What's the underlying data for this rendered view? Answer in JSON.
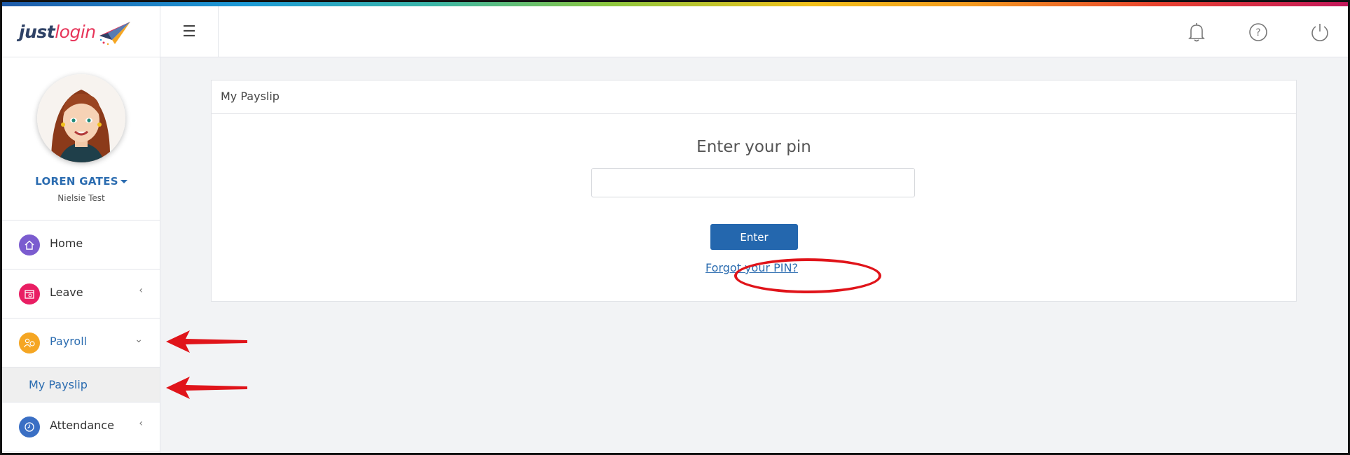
{
  "app": {
    "logo_part1": "just",
    "logo_part2": "login"
  },
  "user": {
    "name": "LOREN GATES",
    "company": "Nielsie Test"
  },
  "sidebar": {
    "items": [
      {
        "label": "Home",
        "icon": "home-icon",
        "color": "#7b5ccf",
        "chevron": ""
      },
      {
        "label": "Leave",
        "icon": "calendar-icon",
        "color": "#e91e63",
        "chevron": "‹"
      },
      {
        "label": "Payroll",
        "icon": "payroll-icon",
        "color": "#f5a623",
        "chevron": "⌄"
      },
      {
        "label": "Attendance",
        "icon": "clock-icon",
        "color": "#3a6fc4",
        "chevron": "‹"
      }
    ],
    "payroll_sub": {
      "label": "My Payslip"
    }
  },
  "topbar": {
    "menu_icon": "☰"
  },
  "panel": {
    "title": "My Payslip",
    "heading": "Enter your pin",
    "pin_value": "",
    "enter_label": "Enter",
    "forgot_label": "Forgot your PIN?"
  },
  "colors": {
    "accent": "#2467ae",
    "annotation": "#e0141a"
  }
}
